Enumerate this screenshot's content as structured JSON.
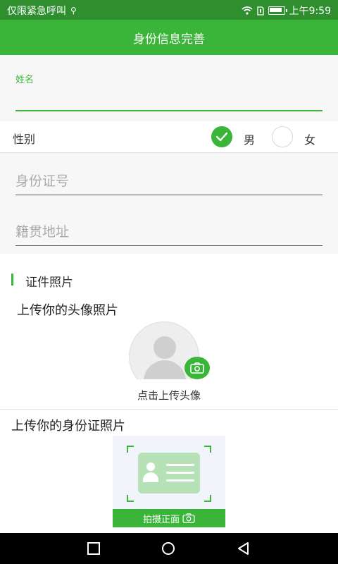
{
  "status_bar": {
    "carrier": "仅限紧急呼叫",
    "time": "上午9:59",
    "battery_level": 0.85
  },
  "header": {
    "title": "身份信息完善"
  },
  "form": {
    "name_label": "姓名",
    "name_value": "",
    "gender": {
      "label": "性别",
      "options": [
        "男",
        "女"
      ],
      "selected": "男"
    },
    "id_number_placeholder": "身份证号",
    "hometown_placeholder": "籍贯地址"
  },
  "photos": {
    "section_title": "证件照片",
    "avatar_heading": "上传你的头像照片",
    "avatar_caption": "点击上传头像",
    "id_heading": "上传你的身份证照片",
    "id_front_button": "拍摄正面"
  },
  "colors": {
    "accent": "#3ab53a",
    "status_bar": "#2f8f2f"
  },
  "icons": [
    "wifi-icon",
    "sim-icon",
    "battery-icon",
    "usb-icon",
    "check-icon",
    "camera-icon",
    "nav-recent-icon",
    "nav-home-icon",
    "nav-back-icon"
  ]
}
